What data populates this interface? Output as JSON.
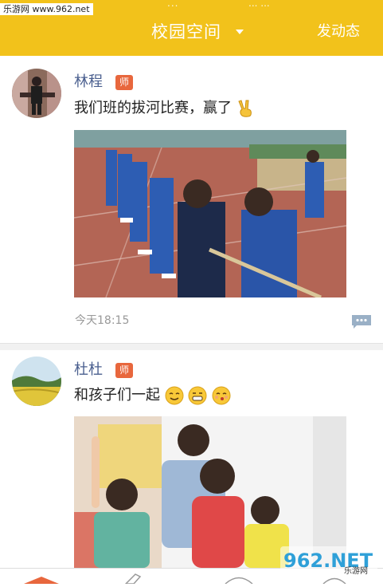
{
  "watermark_top": "乐游网 www.962.net",
  "status": {
    "left": "...",
    "right": "... ..."
  },
  "header": {
    "title": "校园空间",
    "action": "发动态"
  },
  "posts": [
    {
      "author": "林程",
      "role": "师",
      "text": "我们班的拔河比赛，赢了",
      "emoji": [
        "victory-hand"
      ],
      "time": "今天18:15"
    },
    {
      "author": "杜杜",
      "role": "师",
      "text": "和孩子们一起",
      "emoji": [
        "smiling-face",
        "grinning-face",
        "kissing-face"
      ]
    }
  ],
  "watermark_brand": {
    "big": "962.NET",
    "small": "乐游网"
  },
  "colors": {
    "header": "#f2c21b",
    "badge": "#e8673d",
    "author": "#4a5f8f",
    "time": "#999999"
  }
}
